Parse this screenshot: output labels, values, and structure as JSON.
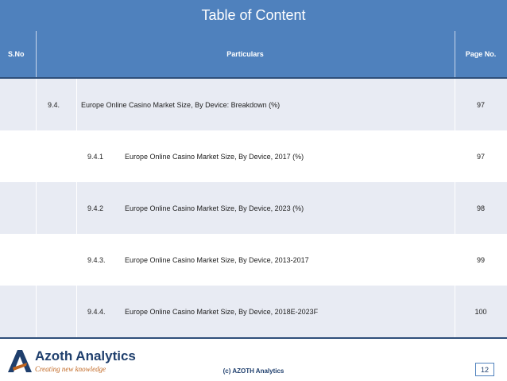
{
  "title": "Table of Content",
  "header": {
    "sno": "S.No",
    "particulars": "Particulars",
    "page": "Page No."
  },
  "rows": [
    {
      "number": "9.4.",
      "label": "Europe  Online Casino Market Size, By Device: Breakdown (%)",
      "page": "97"
    },
    {
      "number": "9.4.1",
      "label": "Europe  Online Casino Market Size, By Device, 2017 (%)",
      "page": "97"
    },
    {
      "number": "9.4.2",
      "label": "Europe  Online Casino  Market Size, By Device, 2023 (%)",
      "page": "98"
    },
    {
      "number": "9.4.3.",
      "label": "Europe  Online Casino  Market Size, By Device, 2013-2017",
      "page": "99"
    },
    {
      "number": "9.4.4.",
      "label": "Europe  Online Casino Market Size, By Device, 2018E-2023F",
      "page": "100"
    }
  ],
  "footer": {
    "brand": "Azoth Analytics",
    "tagline": "Creating new knowledge",
    "copyright": "(c) AZOTH Analytics",
    "page_number": "12"
  },
  "colors": {
    "header_blue": "#4f81bd",
    "row_shade": "#e8ebf3",
    "brand_navy": "#1f3f6d",
    "tagline_orange": "#c0651f"
  }
}
